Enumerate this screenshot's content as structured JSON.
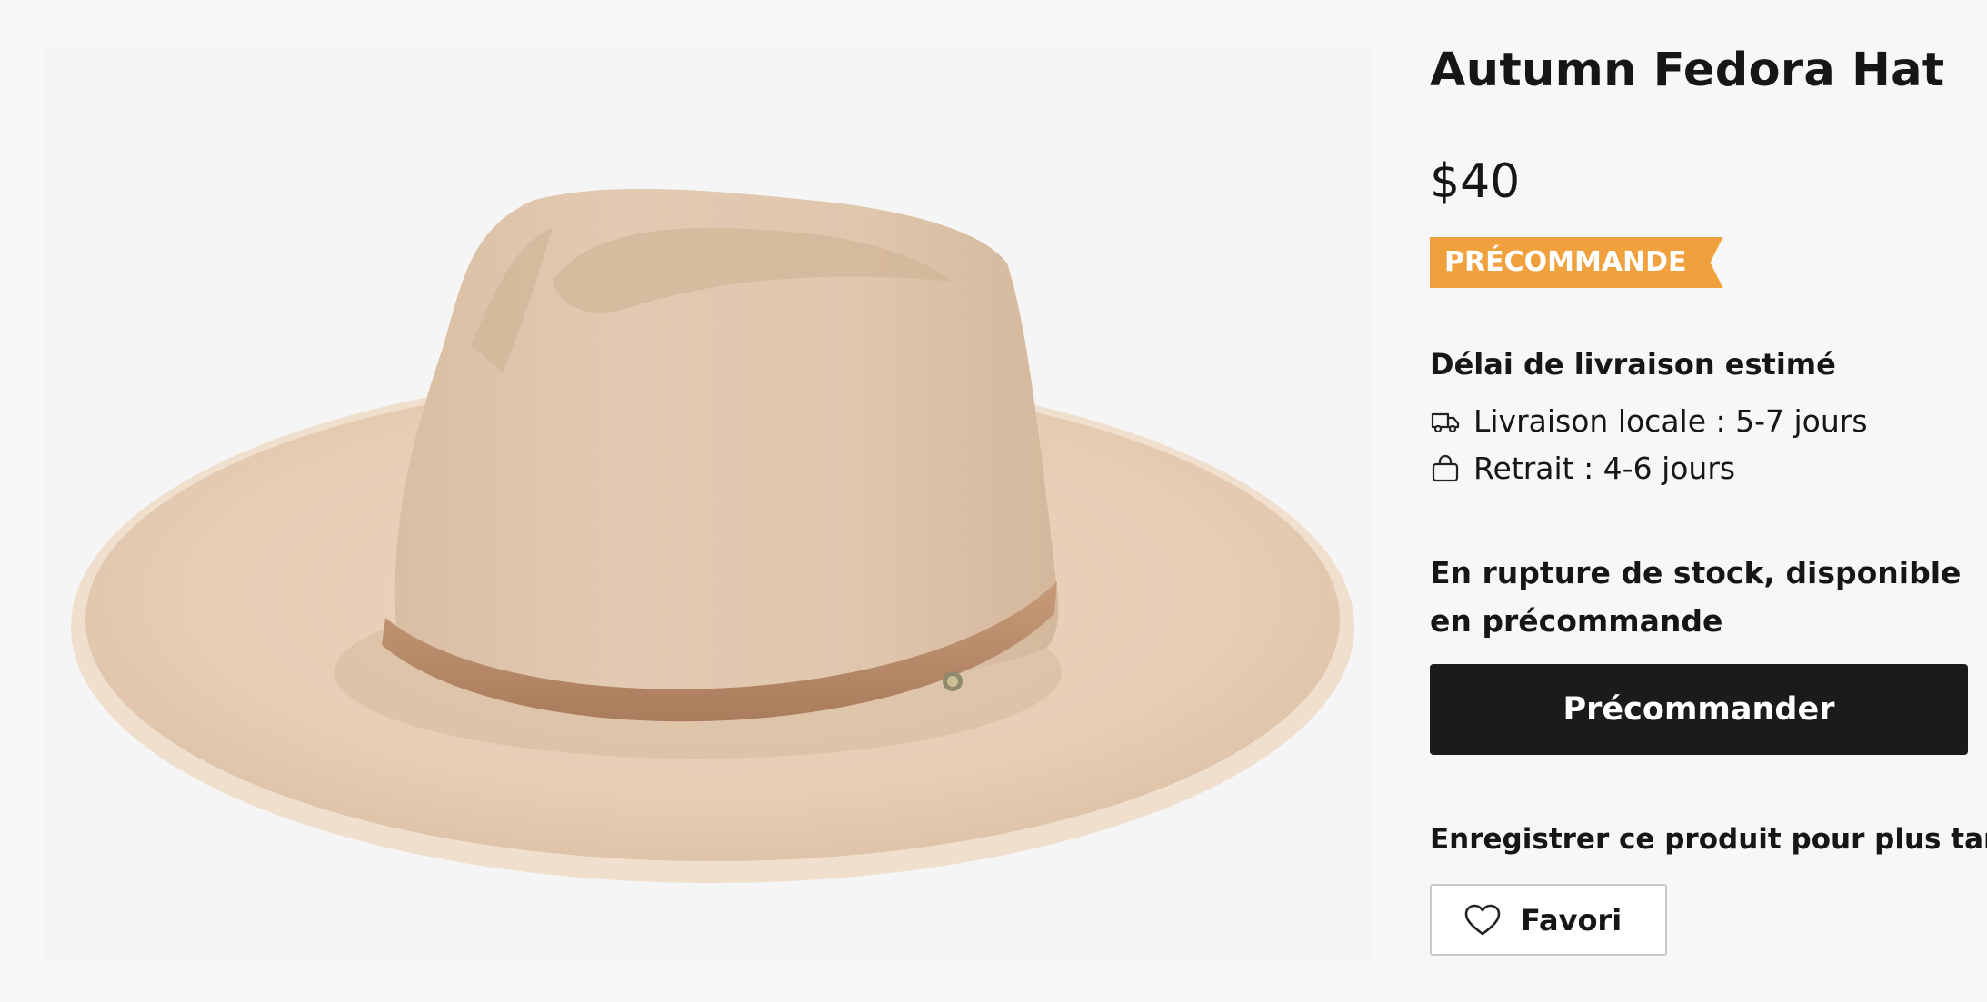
{
  "product": {
    "image_alt": "Autumn Fedora Hat",
    "title": "Autumn Fedora Hat",
    "price": "$40",
    "badge": "PRÉCOMMANDE",
    "badge_color": "#f0a03c"
  },
  "delivery": {
    "heading": "Délai de livraison estimé",
    "local": {
      "icon": "truck-icon",
      "text": "Livraison locale : 5-7 jours"
    },
    "pickup": {
      "icon": "shopping-bag-icon",
      "text": "Retrait : 4-6 jours"
    }
  },
  "stock": {
    "note": "En rupture de stock, disponible en précommande"
  },
  "actions": {
    "preorder_label": "Précommander",
    "save_heading": "Enregistrer ce produit pour plus tard",
    "favorite_label": "Favori",
    "favorite_icon": "heart-icon"
  }
}
